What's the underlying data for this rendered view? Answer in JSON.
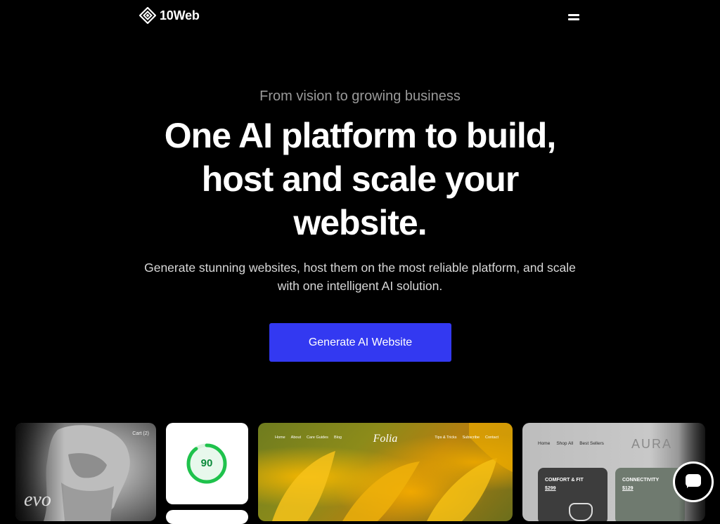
{
  "header": {
    "brand": "10Web",
    "logo_icon": "10web-diamond-logo-icon",
    "menu_icon": "hamburger-menu-icon"
  },
  "hero": {
    "eyebrow": "From vision to growing business",
    "headline": "One AI platform to build, host and scale your website.",
    "subtext": "Generate stunning websites, host them on the most reliable platform, and scale with one intelligent AI solution.",
    "cta_label": "Generate AI Website"
  },
  "showcase": {
    "statue_card": {
      "cart_label": "Cart (2)",
      "word": "evo"
    },
    "score_card": {
      "score": "90",
      "score_value": 90
    },
    "folia_card": {
      "brand": "Folia",
      "nav_left": [
        "Home",
        "About",
        "Care Guides",
        "Blog"
      ],
      "nav_right": [
        "Tips & Tricks",
        "Subscribe",
        "Contact"
      ]
    },
    "aura_card": {
      "brand": "AURA",
      "nav": [
        "Home",
        "Shop All",
        "Best Sellers"
      ],
      "products": [
        {
          "title": "COMFORT & FIT",
          "price": "$299"
        },
        {
          "title": "CONNECTIVITY",
          "price": "$129"
        }
      ]
    }
  },
  "chat": {
    "icon": "chat-bubble-icon"
  },
  "colors": {
    "background": "#000000",
    "cta": "#3339f1",
    "score_ring": "#1fc24c",
    "eyebrow": "#9a9a9a"
  }
}
